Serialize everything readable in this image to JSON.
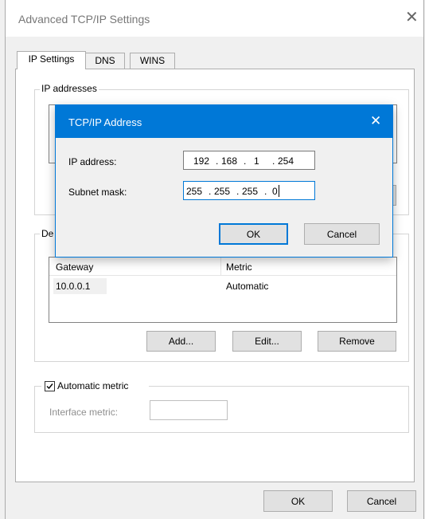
{
  "window": {
    "title": "Advanced TCP/IP Settings",
    "close_glyph": "✕"
  },
  "tabs": [
    {
      "label": "IP Settings",
      "active": true
    },
    {
      "label": "DNS",
      "active": false
    },
    {
      "label": "WINS",
      "active": false
    }
  ],
  "ip_addresses": {
    "legend": "IP addresses"
  },
  "gateways": {
    "legend_visible": "De",
    "columns": [
      "Gateway",
      "Metric"
    ],
    "rows": [
      {
        "gateway": "10.0.0.1",
        "metric": "Automatic"
      }
    ],
    "add_label": "Add...",
    "edit_label": "Edit...",
    "remove_label": "Remove"
  },
  "metric": {
    "auto_label": "Automatic metric",
    "auto_checked": true,
    "interface_label": "Interface metric:",
    "interface_value": ""
  },
  "footer": {
    "ok_label": "OK",
    "cancel_label": "Cancel"
  },
  "dialog": {
    "title": "TCP/IP Address",
    "close_glyph": "✕",
    "ip_label": "IP address:",
    "ip": [
      "192",
      "168",
      "1",
      "254"
    ],
    "mask_label": "Subnet mask:",
    "mask": [
      "255",
      "255",
      "255",
      "0"
    ],
    "ok_label": "OK",
    "cancel_label": "Cancel"
  },
  "colors": {
    "accent": "#0078d7",
    "window_bg": "#f0f0f0",
    "panel_bg": "#ffffff"
  }
}
